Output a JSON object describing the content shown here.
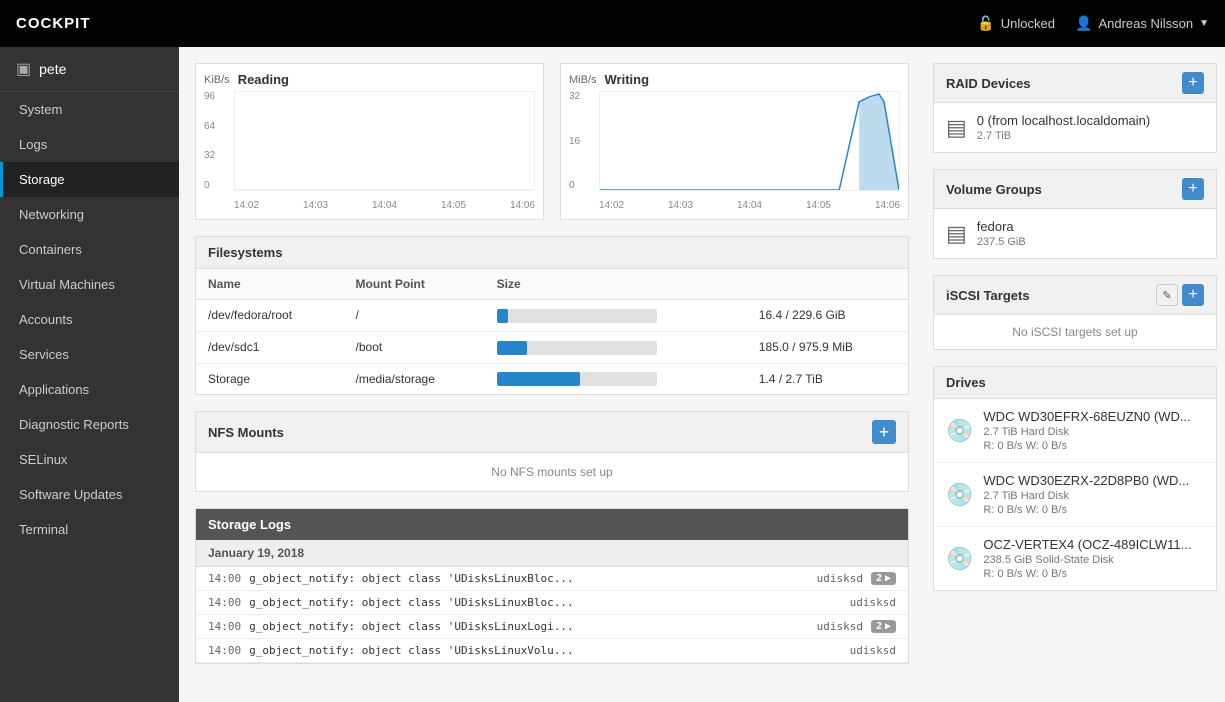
{
  "app": {
    "brand": "COCKPIT"
  },
  "topnav": {
    "unlocked_label": "Unlocked",
    "user_label": "Andreas Nilsson"
  },
  "sidebar": {
    "host_label": "pete",
    "items": [
      {
        "id": "system",
        "label": "System"
      },
      {
        "id": "logs",
        "label": "Logs"
      },
      {
        "id": "storage",
        "label": "Storage",
        "active": true
      },
      {
        "id": "networking",
        "label": "Networking"
      },
      {
        "id": "containers",
        "label": "Containers"
      },
      {
        "id": "virtual-machines",
        "label": "Virtual Machines"
      },
      {
        "id": "accounts",
        "label": "Accounts"
      },
      {
        "id": "services",
        "label": "Services"
      },
      {
        "id": "applications",
        "label": "Applications"
      },
      {
        "id": "diagnostic-reports",
        "label": "Diagnostic Reports"
      },
      {
        "id": "selinux",
        "label": "SELinux"
      },
      {
        "id": "software-updates",
        "label": "Software Updates"
      },
      {
        "id": "terminal",
        "label": "Terminal"
      }
    ]
  },
  "charts": {
    "reading": {
      "title": "Reading",
      "unit": "KiB/s",
      "y_labels": [
        "96",
        "64",
        "32",
        "0"
      ],
      "x_labels": [
        "14:02",
        "14:03",
        "14:04",
        "14:05",
        "14:06"
      ]
    },
    "writing": {
      "title": "Writing",
      "unit": "MiB/s",
      "y_labels": [
        "32",
        "16",
        "0"
      ],
      "x_labels": [
        "14:02",
        "14:03",
        "14:04",
        "14:05",
        "14:06"
      ]
    }
  },
  "filesystems": {
    "section_title": "Filesystems",
    "col_name": "Name",
    "col_mount": "Mount Point",
    "col_size": "Size",
    "rows": [
      {
        "name": "/dev/fedora/root",
        "mount": "/",
        "size_text": "16.4 / 229.6 GiB",
        "usage_pct": 7
      },
      {
        "name": "/dev/sdc1",
        "mount": "/boot",
        "size_text": "185.0 / 975.9 MiB",
        "usage_pct": 19
      },
      {
        "name": "Storage",
        "mount": "/media/storage",
        "size_text": "1.4 / 2.7 TiB",
        "usage_pct": 52
      }
    ]
  },
  "nfs": {
    "section_title": "NFS Mounts",
    "empty_label": "No NFS mounts set up"
  },
  "storage_logs": {
    "section_title": "Storage Logs",
    "date_label": "January 19, 2018",
    "rows": [
      {
        "time": "14:00",
        "msg": "g_object_notify: object class 'UDisksLinuxBloc...",
        "source": "udisksd",
        "badge": "2"
      },
      {
        "time": "14:00",
        "msg": "g_object_notify: object class 'UDisksLinuxBloc...",
        "source": "udisksd",
        "badge": null
      },
      {
        "time": "14:00",
        "msg": "g_object_notify: object class 'UDisksLinuxLogi...",
        "source": "udisksd",
        "badge": "2"
      },
      {
        "time": "14:00",
        "msg": "g_object_notify: object class 'UDisksLinuxVolu...",
        "source": "udisksd",
        "badge": null
      }
    ]
  },
  "right_panel": {
    "raid_devices": {
      "title": "RAID Devices",
      "item": {
        "name": "0 (from localhost.localdomain)",
        "sub": "2.7 TiB"
      }
    },
    "volume_groups": {
      "title": "Volume Groups",
      "item": {
        "name": "fedora",
        "sub": "237.5 GiB"
      }
    },
    "iscsi_targets": {
      "title": "iSCSI Targets",
      "empty_label": "No iSCSI targets set up"
    },
    "drives": {
      "title": "Drives",
      "items": [
        {
          "name": "WDC WD30EFRX-68EUZN0 (WD...",
          "sub1": "2.7 TiB Hard Disk",
          "sub2": "R: 0 B/s      W: 0 B/s"
        },
        {
          "name": "WDC WD30EZRX-22D8PB0 (WD...",
          "sub1": "2.7 TiB Hard Disk",
          "sub2": "R: 0 B/s      W: 0 B/s"
        },
        {
          "name": "OCZ-VERTEX4 (OCZ-489ICLW11...",
          "sub1": "238.5 GiB Solid-State Disk",
          "sub2": "R: 0 B/s      W: 0 B/s"
        }
      ]
    }
  }
}
